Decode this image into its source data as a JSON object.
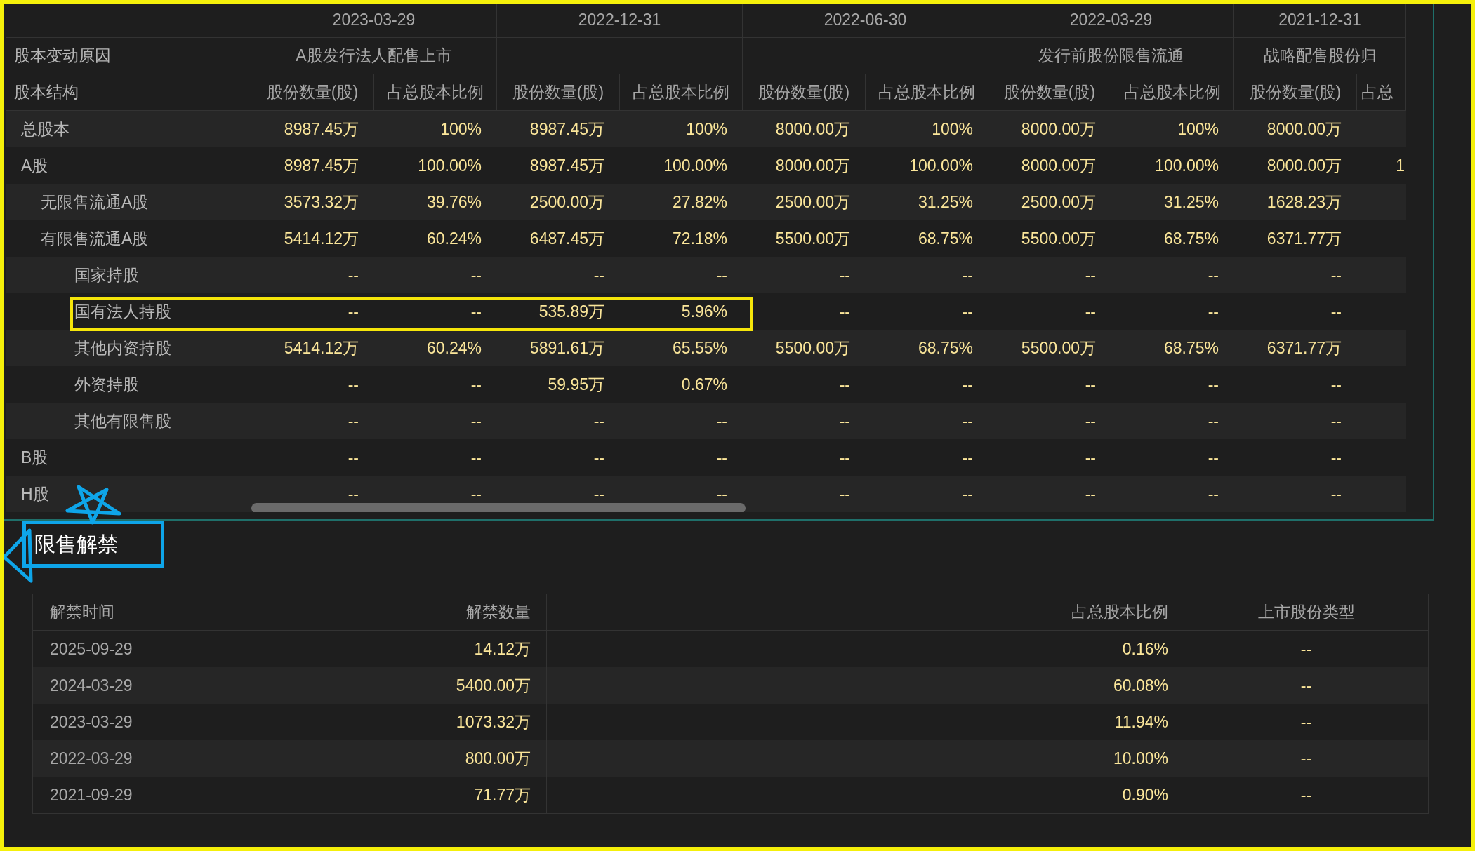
{
  "share_structure": {
    "groups": [
      {
        "date": "2023-03-29",
        "reason": "A股发行法人配售上市"
      },
      {
        "date": "2022-12-31"
      },
      {
        "date": "2022-06-30"
      },
      {
        "date": "2022-03-29",
        "reason": "发行前股份限售流通"
      },
      {
        "date": "2021-12-31",
        "reason": "战略配售股份归"
      }
    ],
    "reason_label": "股本变动原因",
    "structure_label": "股本结构",
    "columns": [
      "股份数量(股)",
      "占总股本比例",
      "股份数量(股)",
      "占总股本比例",
      "股份数量(股)",
      "占总股本比例",
      "股份数量(股)",
      "占总股本比例",
      "股份数量(股)",
      "占总"
    ],
    "rows": [
      {
        "label": "总股本",
        "highlighted": false,
        "values": [
          "8987.45万",
          "100%",
          "8987.45万",
          "100%",
          "8000.00万",
          "100%",
          "8000.00万",
          "100%",
          "8000.00万"
        ]
      },
      {
        "label": "A股",
        "highlighted": false,
        "values": [
          "8987.45万",
          "100.00%",
          "8987.45万",
          "100.00%",
          "8000.00万",
          "100.00%",
          "8000.00万",
          "100.00%",
          "8000.00万"
        ],
        "cut_value": "1",
        "children": [
          {
            "label": "无限售流通A股",
            "highlighted": false,
            "values": [
              "3573.32万",
              "39.76%",
              "2500.00万",
              "27.82%",
              "2500.00万",
              "31.25%",
              "2500.00万",
              "31.25%",
              "1628.23万"
            ]
          },
          {
            "label": "有限售流通A股",
            "highlighted": false,
            "values": [
              "5414.12万",
              "60.24%",
              "6487.45万",
              "72.18%",
              "5500.00万",
              "68.75%",
              "5500.00万",
              "68.75%",
              "6371.77万"
            ],
            "children": [
              {
                "label": "国家持股",
                "highlighted": false,
                "values": [
                  "--",
                  "--",
                  "--",
                  "--",
                  "--",
                  "--",
                  "--",
                  "--",
                  "--"
                ]
              },
              {
                "label": "国有法人持股",
                "highlighted": true,
                "values": [
                  "--",
                  "--",
                  "535.89万",
                  "5.96%",
                  "--",
                  "--",
                  "--",
                  "--",
                  "--"
                ]
              },
              {
                "label": "其他内资持股",
                "highlighted": false,
                "values": [
                  "5414.12万",
                  "60.24%",
                  "5891.61万",
                  "65.55%",
                  "5500.00万",
                  "68.75%",
                  "5500.00万",
                  "68.75%",
                  "6371.77万"
                ]
              },
              {
                "label": "外资持股",
                "highlighted": false,
                "values": [
                  "--",
                  "--",
                  "59.95万",
                  "0.67%",
                  "--",
                  "--",
                  "--",
                  "--",
                  "--"
                ]
              },
              {
                "label": "其他有限售股",
                "highlighted": false,
                "values": [
                  "--",
                  "--",
                  "--",
                  "--",
                  "--",
                  "--",
                  "--",
                  "--",
                  "--"
                ]
              }
            ]
          }
        ]
      },
      {
        "label": "B股",
        "highlighted": false,
        "values": [
          "--",
          "--",
          "--",
          "--",
          "--",
          "--",
          "--",
          "--",
          "--"
        ]
      },
      {
        "label": "H股",
        "highlighted": false,
        "values": [
          "--",
          "--",
          "--",
          "--",
          "--",
          "--",
          "--",
          "--",
          "--"
        ]
      }
    ]
  },
  "unlock": {
    "title": "限售解禁",
    "boxed": true,
    "columns": [
      "解禁时间",
      "解禁数量",
      "占总股本比例",
      "上市股份类型"
    ],
    "rows": [
      {
        "date": "2025-09-29",
        "amount": "14.12万",
        "ratio": "0.16%",
        "type": "--"
      },
      {
        "date": "2024-03-29",
        "amount": "5400.00万",
        "ratio": "60.08%",
        "type": "--"
      },
      {
        "date": "2023-03-29",
        "amount": "1073.32万",
        "ratio": "11.94%",
        "type": "--"
      },
      {
        "date": "2022-03-29",
        "amount": "800.00万",
        "ratio": "10.00%",
        "type": "--"
      },
      {
        "date": "2021-09-29",
        "amount": "71.77万",
        "ratio": "0.90%",
        "type": "--"
      }
    ]
  }
}
